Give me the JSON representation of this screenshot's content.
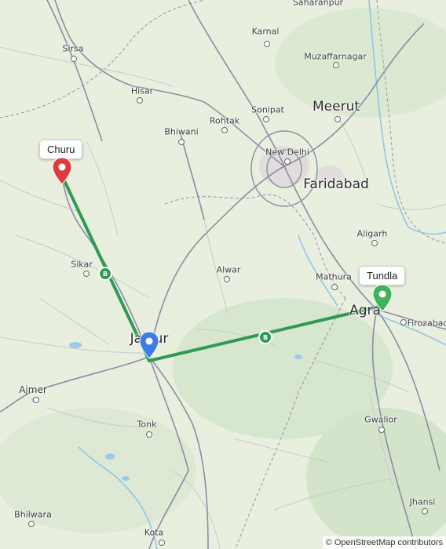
{
  "map": {
    "cities": [
      {
        "id": "saharanpur",
        "name": "Saharanpur",
        "size": "small"
      },
      {
        "id": "karnal",
        "name": "Karnal",
        "size": "small"
      },
      {
        "id": "muzaffarnagar",
        "name": "Muzaffarnagar",
        "size": "small"
      },
      {
        "id": "sirsa",
        "name": "Sirsa",
        "size": "small"
      },
      {
        "id": "hisar",
        "name": "Hisar",
        "size": "small"
      },
      {
        "id": "meerut",
        "name": "Meerut",
        "size": "big"
      },
      {
        "id": "sonipat",
        "name": "Sonipat",
        "size": "small"
      },
      {
        "id": "rohtak",
        "name": "Rohtak",
        "size": "small"
      },
      {
        "id": "bhiwani",
        "name": "Bhiwani",
        "size": "small"
      },
      {
        "id": "new-delhi",
        "name": "New Delhi",
        "size": "small"
      },
      {
        "id": "faridabad",
        "name": "Faridabad",
        "size": "big"
      },
      {
        "id": "aligarh",
        "name": "Aligarh",
        "size": "small"
      },
      {
        "id": "sikar",
        "name": "Sikar",
        "size": "small"
      },
      {
        "id": "alwar",
        "name": "Alwar",
        "size": "small"
      },
      {
        "id": "mathura",
        "name": "Mathura",
        "size": "small"
      },
      {
        "id": "agra",
        "name": "Agra",
        "size": "big"
      },
      {
        "id": "firozabad",
        "name": "Firozabad",
        "size": "small"
      },
      {
        "id": "jaipur",
        "name": "Jaipur",
        "size": "big"
      },
      {
        "id": "ajmer",
        "name": "Ajmer",
        "size": "mid"
      },
      {
        "id": "tonk",
        "name": "Tonk",
        "size": "small"
      },
      {
        "id": "gwalior",
        "name": "Gwalior",
        "size": "small"
      },
      {
        "id": "bhilwara",
        "name": "Bhilwara",
        "size": "small"
      },
      {
        "id": "kota",
        "name": "Kota",
        "size": "small"
      },
      {
        "id": "jhansi",
        "name": "Jhansi",
        "size": "small"
      }
    ],
    "markers": {
      "origin": {
        "label": "Churu",
        "color": "#e03b3b"
      },
      "stop": {
        "label": "Jaipur",
        "color": "#3d7be6"
      },
      "destination": {
        "label": "Tundla",
        "color": "#3fb25a"
      }
    },
    "route_color": "#2e9b54",
    "bus_icon": "bus-icon",
    "attribution": "© OpenStreetMap contributors"
  }
}
